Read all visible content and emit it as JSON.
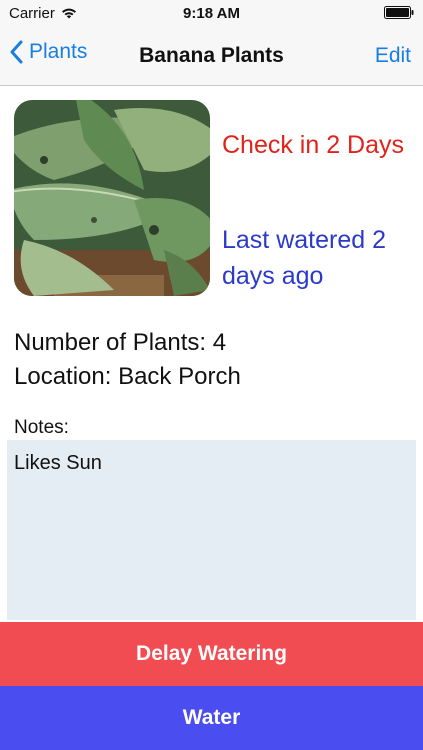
{
  "status_bar": {
    "carrier": "Carrier",
    "time": "9:18 AM"
  },
  "nav": {
    "back_label": "Plants",
    "title": "Banana Plants",
    "edit_label": "Edit"
  },
  "plant": {
    "check_in": "Check in 2 Days",
    "last_watered": "Last watered 2 days ago",
    "number_of_plants": "Number of Plants: 4",
    "location": "Location: Back Porch"
  },
  "notes": {
    "label": "Notes:",
    "text": "Likes Sun"
  },
  "actions": {
    "delay_label": "Delay Watering",
    "water_label": "Water"
  },
  "colors": {
    "accent": "#1a7ee0",
    "check_in": "#e0231b",
    "last_watered": "#2b3ac9",
    "delay": "#f24c53",
    "water": "#4a4df0"
  }
}
